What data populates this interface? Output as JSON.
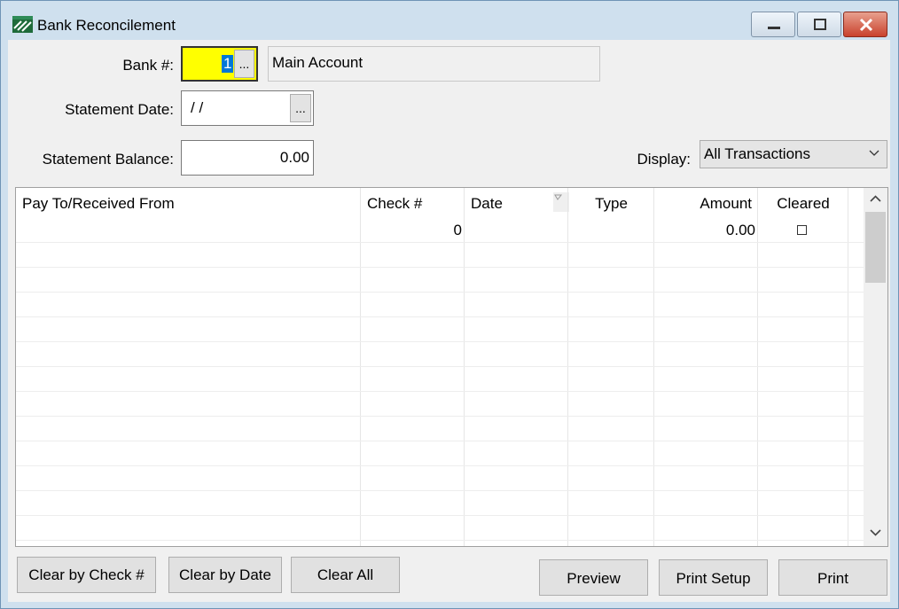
{
  "window": {
    "title": "Bank Reconcilement"
  },
  "form": {
    "bank_label": "Bank #:",
    "bank_value": "1",
    "bank_lookup": "...",
    "bank_name": "Main Account",
    "statement_date_label": "Statement Date:",
    "statement_date_value": "/ /",
    "date_lookup": "...",
    "statement_balance_label": "Statement Balance:",
    "statement_balance_value": "0.00",
    "display_label": "Display:",
    "display_value": "All Transactions"
  },
  "grid": {
    "columns": [
      "Pay To/Received From",
      "Check #",
      "Date",
      "Type",
      "Amount",
      "Cleared"
    ],
    "rows": [
      {
        "pay_to": "",
        "check": "0",
        "date": "",
        "type": "",
        "amount": "0.00",
        "cleared": false
      }
    ]
  },
  "buttons": {
    "clear_by_check": "Clear by Check #",
    "clear_by_date": "Clear by Date",
    "clear_all": "Clear All",
    "preview": "Preview",
    "print_setup": "Print Setup",
    "print": "Print"
  },
  "colors": {
    "bank_field_bg": "#ffff00",
    "selection": "#0078d7"
  }
}
